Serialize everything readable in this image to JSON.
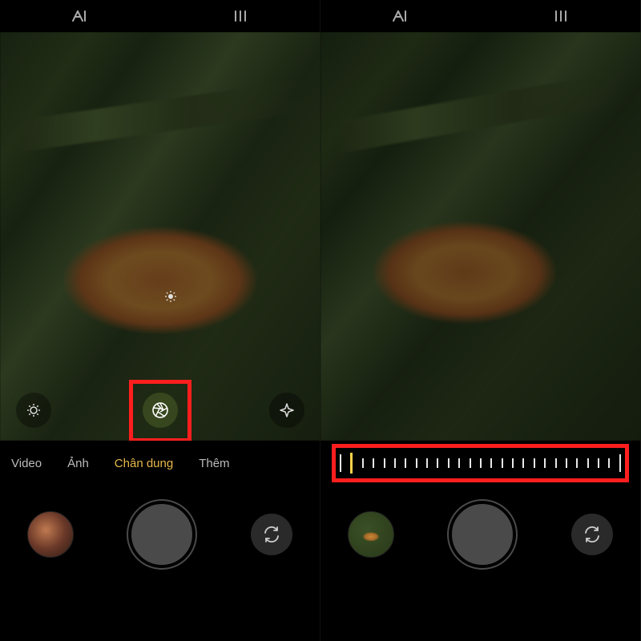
{
  "left": {
    "modes": {
      "video": "Video",
      "photo": "Ảnh",
      "portrait": "Chân dung",
      "more": "Thêm"
    },
    "active_mode": "portrait",
    "icons": {
      "ai": "ai-icon",
      "bars": "menu-bars-icon",
      "brightness": "brightness-icon",
      "aperture": "aperture-icon",
      "effects": "effects-icon",
      "gallery": "gallery-thumbnail",
      "shutter": "shutter-button",
      "switch": "switch-camera-icon",
      "focus_sun": "exposure-sun-icon"
    }
  },
  "right": {
    "icons": {
      "ai": "ai-icon",
      "bars": "menu-bars-icon",
      "gallery": "gallery-thumbnail",
      "shutter": "shutter-button",
      "switch": "switch-camera-icon"
    },
    "slider": {
      "ticks": 27,
      "selected_index": 1
    }
  },
  "colors": {
    "highlight": "#ff1e1e",
    "active_mode": "#e6b84a"
  }
}
